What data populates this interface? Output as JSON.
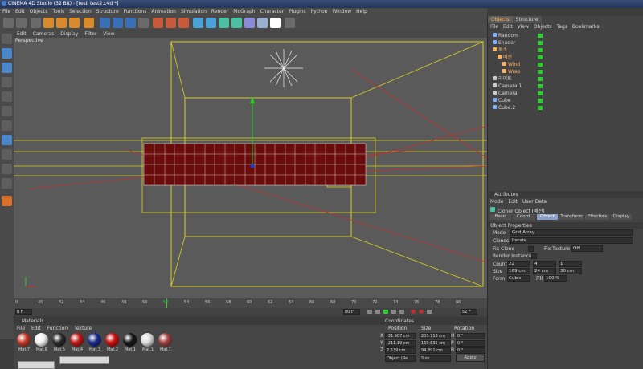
{
  "window": {
    "title": "CINEMA 4D Studio (32 Bit) - [test_test2.c4d *]"
  },
  "menubar": [
    "File",
    "Edit",
    "Objects",
    "Tools",
    "Selection",
    "Structure",
    "Functions",
    "Animation",
    "Simulation",
    "Render",
    "MoGraph",
    "Character",
    "Plugins",
    "Python",
    "Window",
    "Help"
  ],
  "viewport": {
    "menu": [
      "Edit",
      "Cameras",
      "Display",
      "Filter",
      "View"
    ],
    "label": "Perspective"
  },
  "timeline": {
    "ticks": [
      "0",
      "40",
      "42",
      "44",
      "46",
      "48",
      "50",
      "52",
      "54",
      "56",
      "58",
      "60",
      "62",
      "64",
      "66",
      "68",
      "70",
      "72",
      "74",
      "76",
      "78",
      "80"
    ],
    "current_frame": "52",
    "start_field": "0 F",
    "end_field": "80 F",
    "fps_field": "52 F"
  },
  "materials": {
    "title": "Materials",
    "menu": [
      "File",
      "Edit",
      "Function",
      "Texture"
    ],
    "items": [
      {
        "label": "Mat.7",
        "color": "#c43a2a"
      },
      {
        "label": "Mat.6",
        "color": "#f2f2f2"
      },
      {
        "label": "Mat.5",
        "color": "#2a2a2a"
      },
      {
        "label": "Mat.4",
        "color": "#c01818"
      },
      {
        "label": "Mat.3",
        "color": "#1a2a8a"
      },
      {
        "label": "Mat.2",
        "color": "#cc1010"
      },
      {
        "label": "Mat.1",
        "color": "#181818"
      },
      {
        "label": "Mat.1",
        "color": "#dcdcdc"
      },
      {
        "label": "Mat.1",
        "color": "#a04040"
      }
    ]
  },
  "coordinates": {
    "title": "Coordinates",
    "headers": {
      "position": "Position",
      "size": "Size",
      "rotation": "Rotation"
    },
    "rows": [
      {
        "axis": "X",
        "pos": "-31.907 cm",
        "size": "203.718 cm",
        "rot_axis": "H",
        "rot": "0 °"
      },
      {
        "axis": "Y",
        "pos": "-211.19 cm",
        "size": "169.635 cm",
        "rot_axis": "P",
        "rot": "0 °"
      },
      {
        "axis": "Z",
        "pos": "2.539 cm",
        "size": "94.391 cm",
        "rot_axis": "B",
        "rot": "0 °"
      }
    ],
    "mode_select": "Object (Re",
    "size_select": "Size",
    "apply": "Apply"
  },
  "object_manager": {
    "tabs": [
      "Objects",
      "Structure"
    ],
    "menu": [
      "File",
      "Edit",
      "View",
      "Objects",
      "Tags",
      "Bookmarks"
    ],
    "items": [
      {
        "name": "Random",
        "indent": 0,
        "icon_color": "#7fb0ff"
      },
      {
        "name": "Shader",
        "indent": 0,
        "icon_color": "#7fb0ff"
      },
      {
        "name": "복소",
        "indent": 0,
        "icon_color": "#ffb060",
        "highlight": true
      },
      {
        "name": "배선",
        "indent": 1,
        "icon_color": "#ffb060",
        "highlight": true
      },
      {
        "name": "Wind",
        "indent": 2,
        "icon_color": "#ffb060",
        "highlight": true
      },
      {
        "name": "Wrap",
        "indent": 2,
        "icon_color": "#ffb060",
        "highlight": true
      },
      {
        "name": "라이트",
        "indent": 0,
        "icon_color": "#cccccc"
      },
      {
        "name": "Camera.1",
        "indent": 0,
        "icon_color": "#cccccc"
      },
      {
        "name": "Camera",
        "indent": 0,
        "icon_color": "#cccccc"
      },
      {
        "name": "Cube",
        "indent": 0,
        "icon_color": "#7fb0ff"
      },
      {
        "name": "Cube.2",
        "indent": 0,
        "icon_color": "#7fb0ff"
      }
    ]
  },
  "attributes": {
    "title": "Attributes",
    "menu": [
      "Mode",
      "Edit",
      "User Data"
    ],
    "object_title": "Cloner Object [배선]",
    "tabs": [
      "Basic",
      "Coord.",
      "Object",
      "Transform",
      "Effectors",
      "Display"
    ],
    "section": "Object Properties",
    "mode_label": "Mode",
    "mode_value": "Grid Array",
    "clones_label": "Clones",
    "clones_value": "Iterate",
    "fix_clone_label": "Fix Clone",
    "fix_texture_label": "Fix Texture",
    "fix_texture_value": "Off",
    "render_instances_label": "Render Instances",
    "count_label": "Count",
    "count_values": [
      "22",
      "4",
      "1"
    ],
    "size_label": "Size",
    "size_values": [
      "169 cm",
      "24 cm",
      "30 cm"
    ],
    "form_label": "Form",
    "form_value": "Cubic",
    "fill_label": "Fill",
    "fill_value": "100 %"
  }
}
